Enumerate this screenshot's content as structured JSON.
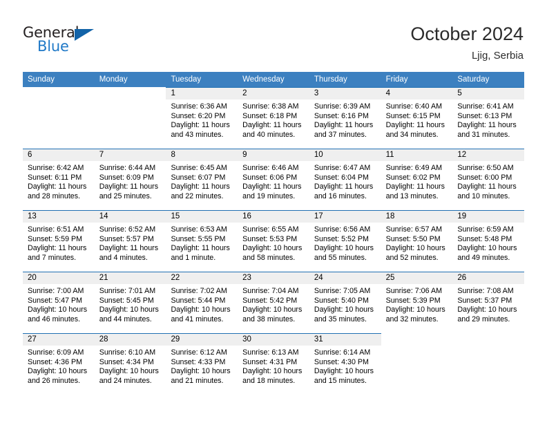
{
  "brand": {
    "name_top": "General",
    "name_bottom": "Blue",
    "color_dark": "#231f20",
    "color_blue": "#2079c7",
    "triangle_color": "#1263a8"
  },
  "header": {
    "title": "October 2024",
    "subtitle": "Ljig, Serbia"
  },
  "theme": {
    "header_bar": "#3c80c0",
    "cell_band": "#efefef",
    "cell_top_border": "#1f6fb2",
    "text": "#000000"
  },
  "weekdays": [
    "Sunday",
    "Monday",
    "Tuesday",
    "Wednesday",
    "Thursday",
    "Friday",
    "Saturday"
  ],
  "weeks": [
    [
      {
        "day": "",
        "lines": []
      },
      {
        "day": "",
        "lines": []
      },
      {
        "day": "1",
        "lines": [
          "Sunrise: 6:36 AM",
          "Sunset: 6:20 PM",
          "Daylight: 11 hours",
          "and 43 minutes."
        ]
      },
      {
        "day": "2",
        "lines": [
          "Sunrise: 6:38 AM",
          "Sunset: 6:18 PM",
          "Daylight: 11 hours",
          "and 40 minutes."
        ]
      },
      {
        "day": "3",
        "lines": [
          "Sunrise: 6:39 AM",
          "Sunset: 6:16 PM",
          "Daylight: 11 hours",
          "and 37 minutes."
        ]
      },
      {
        "day": "4",
        "lines": [
          "Sunrise: 6:40 AM",
          "Sunset: 6:15 PM",
          "Daylight: 11 hours",
          "and 34 minutes."
        ]
      },
      {
        "day": "5",
        "lines": [
          "Sunrise: 6:41 AM",
          "Sunset: 6:13 PM",
          "Daylight: 11 hours",
          "and 31 minutes."
        ]
      }
    ],
    [
      {
        "day": "6",
        "lines": [
          "Sunrise: 6:42 AM",
          "Sunset: 6:11 PM",
          "Daylight: 11 hours",
          "and 28 minutes."
        ]
      },
      {
        "day": "7",
        "lines": [
          "Sunrise: 6:44 AM",
          "Sunset: 6:09 PM",
          "Daylight: 11 hours",
          "and 25 minutes."
        ]
      },
      {
        "day": "8",
        "lines": [
          "Sunrise: 6:45 AM",
          "Sunset: 6:07 PM",
          "Daylight: 11 hours",
          "and 22 minutes."
        ]
      },
      {
        "day": "9",
        "lines": [
          "Sunrise: 6:46 AM",
          "Sunset: 6:06 PM",
          "Daylight: 11 hours",
          "and 19 minutes."
        ]
      },
      {
        "day": "10",
        "lines": [
          "Sunrise: 6:47 AM",
          "Sunset: 6:04 PM",
          "Daylight: 11 hours",
          "and 16 minutes."
        ]
      },
      {
        "day": "11",
        "lines": [
          "Sunrise: 6:49 AM",
          "Sunset: 6:02 PM",
          "Daylight: 11 hours",
          "and 13 minutes."
        ]
      },
      {
        "day": "12",
        "lines": [
          "Sunrise: 6:50 AM",
          "Sunset: 6:00 PM",
          "Daylight: 11 hours",
          "and 10 minutes."
        ]
      }
    ],
    [
      {
        "day": "13",
        "lines": [
          "Sunrise: 6:51 AM",
          "Sunset: 5:59 PM",
          "Daylight: 11 hours",
          "and 7 minutes."
        ]
      },
      {
        "day": "14",
        "lines": [
          "Sunrise: 6:52 AM",
          "Sunset: 5:57 PM",
          "Daylight: 11 hours",
          "and 4 minutes."
        ]
      },
      {
        "day": "15",
        "lines": [
          "Sunrise: 6:53 AM",
          "Sunset: 5:55 PM",
          "Daylight: 11 hours",
          "and 1 minute."
        ]
      },
      {
        "day": "16",
        "lines": [
          "Sunrise: 6:55 AM",
          "Sunset: 5:53 PM",
          "Daylight: 10 hours",
          "and 58 minutes."
        ]
      },
      {
        "day": "17",
        "lines": [
          "Sunrise: 6:56 AM",
          "Sunset: 5:52 PM",
          "Daylight: 10 hours",
          "and 55 minutes."
        ]
      },
      {
        "day": "18",
        "lines": [
          "Sunrise: 6:57 AM",
          "Sunset: 5:50 PM",
          "Daylight: 10 hours",
          "and 52 minutes."
        ]
      },
      {
        "day": "19",
        "lines": [
          "Sunrise: 6:59 AM",
          "Sunset: 5:48 PM",
          "Daylight: 10 hours",
          "and 49 minutes."
        ]
      }
    ],
    [
      {
        "day": "20",
        "lines": [
          "Sunrise: 7:00 AM",
          "Sunset: 5:47 PM",
          "Daylight: 10 hours",
          "and 46 minutes."
        ]
      },
      {
        "day": "21",
        "lines": [
          "Sunrise: 7:01 AM",
          "Sunset: 5:45 PM",
          "Daylight: 10 hours",
          "and 44 minutes."
        ]
      },
      {
        "day": "22",
        "lines": [
          "Sunrise: 7:02 AM",
          "Sunset: 5:44 PM",
          "Daylight: 10 hours",
          "and 41 minutes."
        ]
      },
      {
        "day": "23",
        "lines": [
          "Sunrise: 7:04 AM",
          "Sunset: 5:42 PM",
          "Daylight: 10 hours",
          "and 38 minutes."
        ]
      },
      {
        "day": "24",
        "lines": [
          "Sunrise: 7:05 AM",
          "Sunset: 5:40 PM",
          "Daylight: 10 hours",
          "and 35 minutes."
        ]
      },
      {
        "day": "25",
        "lines": [
          "Sunrise: 7:06 AM",
          "Sunset: 5:39 PM",
          "Daylight: 10 hours",
          "and 32 minutes."
        ]
      },
      {
        "day": "26",
        "lines": [
          "Sunrise: 7:08 AM",
          "Sunset: 5:37 PM",
          "Daylight: 10 hours",
          "and 29 minutes."
        ]
      }
    ],
    [
      {
        "day": "27",
        "lines": [
          "Sunrise: 6:09 AM",
          "Sunset: 4:36 PM",
          "Daylight: 10 hours",
          "and 26 minutes."
        ]
      },
      {
        "day": "28",
        "lines": [
          "Sunrise: 6:10 AM",
          "Sunset: 4:34 PM",
          "Daylight: 10 hours",
          "and 24 minutes."
        ]
      },
      {
        "day": "29",
        "lines": [
          "Sunrise: 6:12 AM",
          "Sunset: 4:33 PM",
          "Daylight: 10 hours",
          "and 21 minutes."
        ]
      },
      {
        "day": "30",
        "lines": [
          "Sunrise: 6:13 AM",
          "Sunset: 4:31 PM",
          "Daylight: 10 hours",
          "and 18 minutes."
        ]
      },
      {
        "day": "31",
        "lines": [
          "Sunrise: 6:14 AM",
          "Sunset: 4:30 PM",
          "Daylight: 10 hours",
          "and 15 minutes."
        ]
      },
      {
        "day": "",
        "lines": []
      },
      {
        "day": "",
        "lines": []
      }
    ]
  ]
}
